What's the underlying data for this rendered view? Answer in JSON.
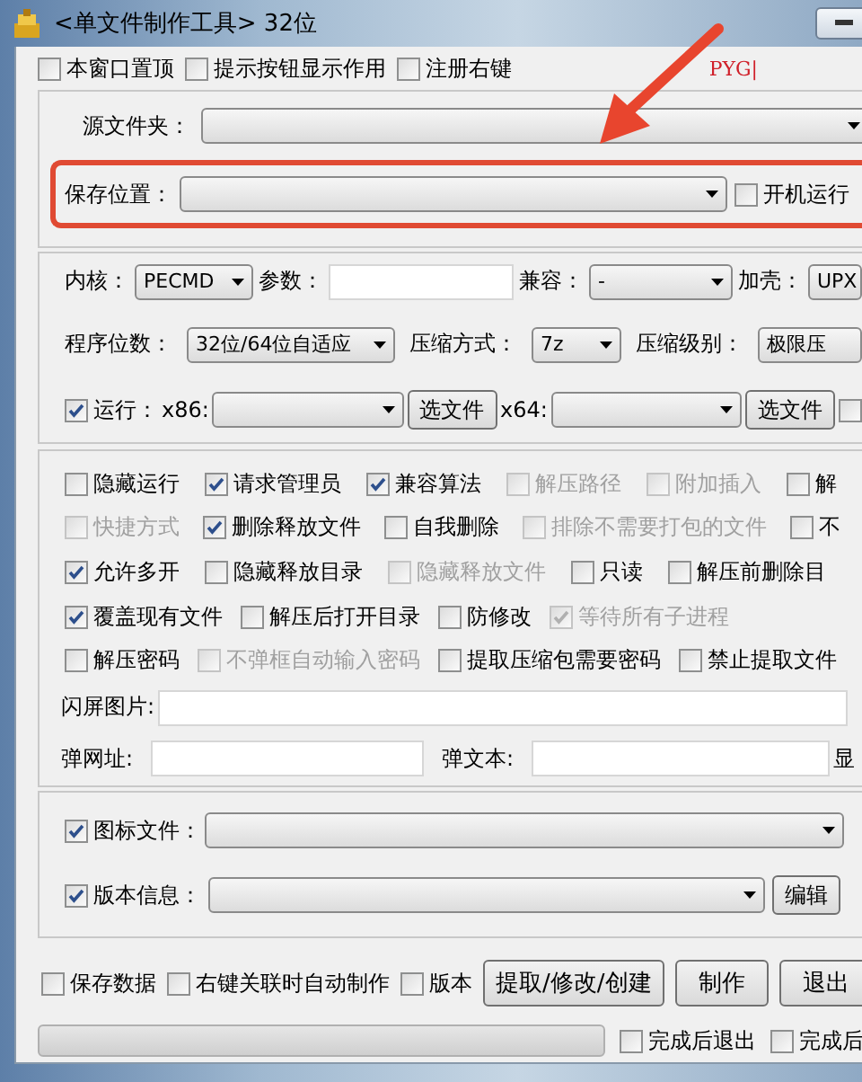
{
  "window": {
    "title": "<单文件制作工具> 32位"
  },
  "top_options": [
    {
      "label": "本窗口置顶",
      "checked": false
    },
    {
      "label": "提示按钮显示作用",
      "checked": false
    },
    {
      "label": "注册右键",
      "checked": false
    }
  ],
  "note": "PYG|",
  "source": {
    "label": "源文件夹："
  },
  "save": {
    "label": "保存位置：",
    "autostart": {
      "label": "开机运行",
      "checked": false
    }
  },
  "core": {
    "label": "内核：",
    "value": "PECMD"
  },
  "params": {
    "label": "参数："
  },
  "compat": {
    "label": "兼容：",
    "value": "-"
  },
  "packer": {
    "label": "加壳：",
    "value": "UPX"
  },
  "bits": {
    "label": "程序位数：",
    "value": "32位/64位自适应"
  },
  "method": {
    "label": "压缩方式：",
    "value": "7z"
  },
  "compression": {
    "label": "压缩级别：",
    "value": "极限压"
  },
  "run": {
    "label": "运行：",
    "checked": true,
    "x86_label": "x86:",
    "x64_label": "x64:",
    "buttons": [
      "选文件",
      "选文件"
    ],
    "extra_checked": false
  },
  "options": [
    [
      {
        "label": "隐藏运行",
        "checked": false,
        "disabled": false
      },
      {
        "label": "请求管理员",
        "checked": true,
        "disabled": false
      },
      {
        "label": "兼容算法",
        "checked": true,
        "disabled": false
      },
      {
        "label": "解压路径",
        "checked": false,
        "disabled": true
      },
      {
        "label": "附加插入",
        "checked": false,
        "disabled": true
      },
      {
        "label": "解",
        "checked": false,
        "disabled": false
      }
    ],
    [
      {
        "label": "快捷方式",
        "checked": false,
        "disabled": true
      },
      {
        "label": "删除释放文件",
        "checked": true,
        "disabled": false
      },
      {
        "label": "自我删除",
        "checked": false,
        "disabled": false
      },
      {
        "label": "排除不需要打包的文件",
        "checked": false,
        "disabled": true
      },
      {
        "label": "不",
        "checked": false,
        "disabled": false
      }
    ],
    [
      {
        "label": "允许多开",
        "checked": true,
        "disabled": false
      },
      {
        "label": "隐藏释放目录",
        "checked": false,
        "disabled": false
      },
      {
        "label": "隐藏释放文件",
        "checked": false,
        "disabled": true
      },
      {
        "label": "只读",
        "checked": false,
        "disabled": false
      },
      {
        "label": "解压前删除目",
        "checked": false,
        "disabled": false
      }
    ],
    [
      {
        "label": "覆盖现有文件",
        "checked": true,
        "disabled": false
      },
      {
        "label": "解压后打开目录",
        "checked": false,
        "disabled": false
      },
      {
        "label": "防修改",
        "checked": false,
        "disabled": false
      },
      {
        "label": "等待所有子进程",
        "checked": true,
        "disabled": true
      }
    ],
    [
      {
        "label": "解压密码",
        "checked": false,
        "disabled": false
      },
      {
        "label": "不弹框自动输入密码",
        "checked": false,
        "disabled": true
      },
      {
        "label": "提取压缩包需要密码",
        "checked": false,
        "disabled": false
      },
      {
        "label": "禁止提取文件",
        "checked": false,
        "disabled": false
      }
    ]
  ],
  "splash": {
    "label": "闪屏图片:"
  },
  "popup_url": {
    "label": "弹网址:"
  },
  "popup_text": {
    "label": "弹文本:"
  },
  "show_label": "显",
  "icon_file": {
    "label": "图标文件：",
    "checked": true
  },
  "version_info": {
    "label": "版本信息：",
    "checked": true,
    "button": "编辑"
  },
  "bottom_options": [
    {
      "label": "保存数据",
      "checked": false
    },
    {
      "label": "右键关联时自动制作",
      "checked": false
    },
    {
      "label": "版本",
      "checked": false
    }
  ],
  "actions": [
    "提取/修改/创建",
    "制作",
    "退出"
  ],
  "progress": {
    "level": 0
  },
  "finish_options": [
    {
      "label": "完成后退出",
      "checked": false
    },
    {
      "label": "完成后",
      "checked": false
    }
  ]
}
